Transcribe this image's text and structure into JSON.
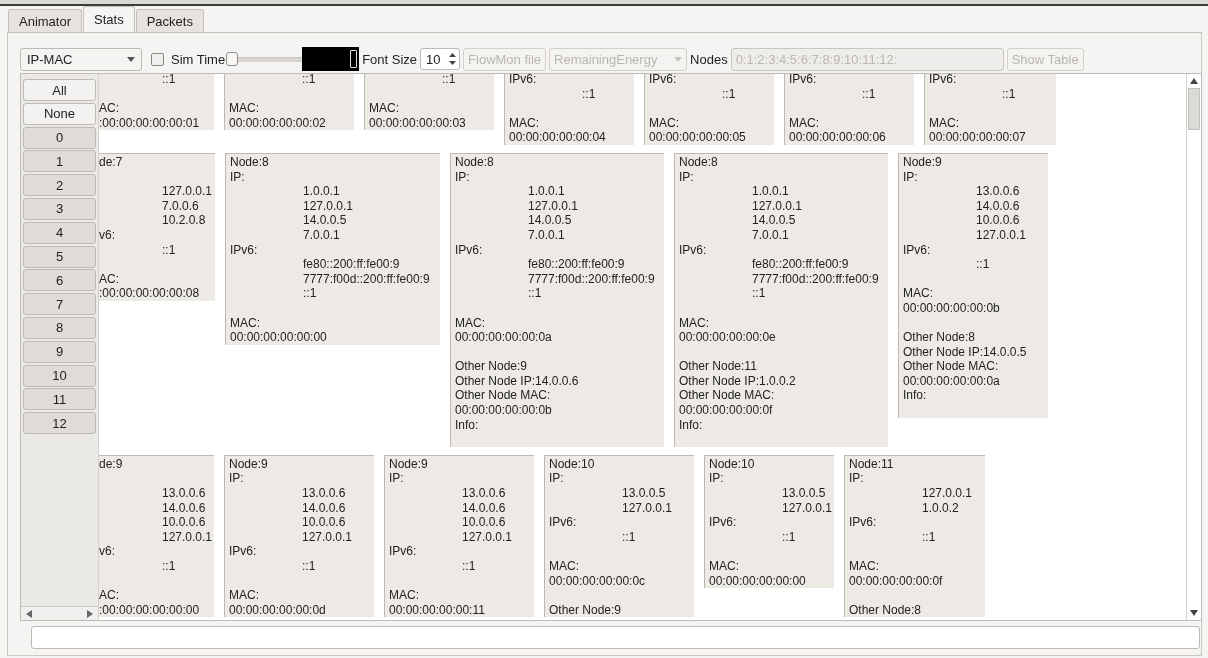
{
  "tabs": [
    {
      "label": "Animator",
      "selected": false
    },
    {
      "label": "Stats",
      "selected": true
    },
    {
      "label": "Packets",
      "selected": false
    }
  ],
  "toolbar": {
    "mode": "IP-MAC",
    "sim_time": {
      "label": "Sim Time",
      "checked": false,
      "level": 0
    },
    "font_size": {
      "label": "Font Size",
      "value": "10"
    },
    "flowmon_button": {
      "label": "FlowMon file",
      "disabled": true
    },
    "metric": {
      "value": "RemainingEnergy",
      "disabled": true
    },
    "nodes": {
      "label": "Nodes",
      "value": "0:1:2:3:4:5:6:7:8:9:10:11:12:",
      "disabled": true
    },
    "show_table": {
      "label": "Show Table",
      "disabled": true
    }
  },
  "node_filter": {
    "actions": [
      "All",
      "None"
    ],
    "nodes": [
      {
        "label": "0",
        "selected": true
      },
      {
        "label": "1",
        "selected": true
      },
      {
        "label": "2",
        "selected": true
      },
      {
        "label": "3",
        "selected": true
      },
      {
        "label": "4",
        "selected": true
      },
      {
        "label": "5",
        "selected": true
      },
      {
        "label": "6",
        "selected": true
      },
      {
        "label": "7",
        "selected": true
      },
      {
        "label": "8",
        "selected": true
      },
      {
        "label": "9",
        "selected": true
      },
      {
        "label": "10",
        "selected": true
      },
      {
        "label": "11",
        "selected": true
      },
      {
        "label": "12",
        "selected": true
      }
    ]
  },
  "card_rows": [
    [
      {
        "lines": [
          {
            "kind": "value",
            "text": "::1"
          },
          {
            "kind": "blank"
          },
          {
            "kind": "label",
            "text": "AC:"
          },
          {
            "kind": "label",
            "text": ":00:00:00:00:00:01"
          }
        ]
      },
      {
        "lines": [
          {
            "kind": "value",
            "text": "::1"
          },
          {
            "kind": "blank"
          },
          {
            "kind": "label",
            "text": "MAC:"
          },
          {
            "kind": "label",
            "text": "00:00:00:00:00:02"
          }
        ]
      },
      {
        "lines": [
          {
            "kind": "value",
            "text": "::1"
          },
          {
            "kind": "blank"
          },
          {
            "kind": "label",
            "text": "MAC:"
          },
          {
            "kind": "label",
            "text": "00:00:00:00:00:03"
          }
        ]
      },
      {
        "lines": [
          {
            "kind": "label",
            "text": "IPv6:"
          },
          {
            "kind": "value",
            "text": "::1"
          },
          {
            "kind": "blank"
          },
          {
            "kind": "label",
            "text": "MAC:"
          },
          {
            "kind": "label",
            "text": "00:00:00:00:00:04"
          }
        ]
      },
      {
        "lines": [
          {
            "kind": "label",
            "text": "IPv6:"
          },
          {
            "kind": "value",
            "text": "::1"
          },
          {
            "kind": "blank"
          },
          {
            "kind": "label",
            "text": "MAC:"
          },
          {
            "kind": "label",
            "text": "00:00:00:00:00:05"
          }
        ]
      },
      {
        "lines": [
          {
            "kind": "label",
            "text": "IPv6:"
          },
          {
            "kind": "value",
            "text": "::1"
          },
          {
            "kind": "blank"
          },
          {
            "kind": "label",
            "text": "MAC:"
          },
          {
            "kind": "label",
            "text": "00:00:00:00:00:06"
          }
        ]
      },
      {
        "lines": [
          {
            "kind": "label",
            "text": "IPv6:"
          },
          {
            "kind": "value",
            "text": "::1"
          },
          {
            "kind": "blank"
          },
          {
            "kind": "label",
            "text": "MAC:"
          },
          {
            "kind": "label",
            "text": "00:00:00:00:00:07"
          }
        ]
      }
    ],
    [
      {
        "lines": [
          {
            "kind": "label",
            "text": "de:7"
          },
          {
            "kind": "blank"
          },
          {
            "kind": "value",
            "text": "127.0.0.1"
          },
          {
            "kind": "value",
            "text": "7.0.0.6"
          },
          {
            "kind": "value",
            "text": "10.2.0.8"
          },
          {
            "kind": "label",
            "text": "v6:"
          },
          {
            "kind": "value",
            "text": "::1"
          },
          {
            "kind": "blank"
          },
          {
            "kind": "label",
            "text": "AC:"
          },
          {
            "kind": "label",
            "text": ":00:00:00:00:00:08"
          }
        ]
      },
      {
        "lines": [
          {
            "kind": "label",
            "text": "Node:8"
          },
          {
            "kind": "label",
            "text": "IP:"
          },
          {
            "kind": "value",
            "text": "1.0.0.1"
          },
          {
            "kind": "value",
            "text": "127.0.0.1"
          },
          {
            "kind": "value",
            "text": "14.0.0.5"
          },
          {
            "kind": "value",
            "text": "7.0.0.1"
          },
          {
            "kind": "label",
            "text": "IPv6:"
          },
          {
            "kind": "value",
            "text": "fe80::200:ff:fe00:9"
          },
          {
            "kind": "value",
            "text": "7777:f00d::200:ff:fe00:9"
          },
          {
            "kind": "value",
            "text": "::1"
          },
          {
            "kind": "blank"
          },
          {
            "kind": "label",
            "text": "MAC:"
          },
          {
            "kind": "label",
            "text": "00:00:00:00:00:00"
          }
        ]
      },
      {
        "lines": [
          {
            "kind": "label",
            "text": "Node:8"
          },
          {
            "kind": "label",
            "text": "IP:"
          },
          {
            "kind": "value",
            "text": "1.0.0.1"
          },
          {
            "kind": "value",
            "text": "127.0.0.1"
          },
          {
            "kind": "value",
            "text": "14.0.0.5"
          },
          {
            "kind": "value",
            "text": "7.0.0.1"
          },
          {
            "kind": "label",
            "text": "IPv6:"
          },
          {
            "kind": "value",
            "text": "fe80::200:ff:fe00:9"
          },
          {
            "kind": "value",
            "text": "7777:f00d::200:ff:fe00:9"
          },
          {
            "kind": "value",
            "text": "::1"
          },
          {
            "kind": "blank"
          },
          {
            "kind": "label",
            "text": "MAC:"
          },
          {
            "kind": "label",
            "text": "00:00:00:00:00:0a"
          },
          {
            "kind": "blank"
          },
          {
            "kind": "label",
            "text": "Other Node:9"
          },
          {
            "kind": "label",
            "text": "Other Node IP:14.0.0.6"
          },
          {
            "kind": "label",
            "text": "Other Node MAC:"
          },
          {
            "kind": "label",
            "text": "00:00:00:00:00:0b"
          },
          {
            "kind": "label",
            "text": "Info:"
          },
          {
            "kind": "blank"
          }
        ]
      },
      {
        "lines": [
          {
            "kind": "label",
            "text": "Node:8"
          },
          {
            "kind": "label",
            "text": "IP:"
          },
          {
            "kind": "value",
            "text": "1.0.0.1"
          },
          {
            "kind": "value",
            "text": "127.0.0.1"
          },
          {
            "kind": "value",
            "text": "14.0.0.5"
          },
          {
            "kind": "value",
            "text": "7.0.0.1"
          },
          {
            "kind": "label",
            "text": "IPv6:"
          },
          {
            "kind": "value",
            "text": "fe80::200:ff:fe00:9"
          },
          {
            "kind": "value",
            "text": "7777:f00d::200:ff:fe00:9"
          },
          {
            "kind": "value",
            "text": "::1"
          },
          {
            "kind": "blank"
          },
          {
            "kind": "label",
            "text": "MAC:"
          },
          {
            "kind": "label",
            "text": "00:00:00:00:00:0e"
          },
          {
            "kind": "blank"
          },
          {
            "kind": "label",
            "text": "Other Node:11"
          },
          {
            "kind": "label",
            "text": "Other Node IP:1.0.0.2"
          },
          {
            "kind": "label",
            "text": "Other Node MAC:"
          },
          {
            "kind": "label",
            "text": "00:00:00:00:00:0f"
          },
          {
            "kind": "label",
            "text": "Info:"
          },
          {
            "kind": "blank"
          }
        ]
      },
      {
        "lines": [
          {
            "kind": "label",
            "text": "Node:9"
          },
          {
            "kind": "label",
            "text": "IP:"
          },
          {
            "kind": "value",
            "text": "13.0.0.6"
          },
          {
            "kind": "value",
            "text": "14.0.0.6"
          },
          {
            "kind": "value",
            "text": "10.0.0.6"
          },
          {
            "kind": "value",
            "text": "127.0.0.1"
          },
          {
            "kind": "label",
            "text": "IPv6:"
          },
          {
            "kind": "value",
            "text": "::1"
          },
          {
            "kind": "blank"
          },
          {
            "kind": "label",
            "text": "MAC:"
          },
          {
            "kind": "label",
            "text": "00:00:00:00:00:0b"
          },
          {
            "kind": "blank"
          },
          {
            "kind": "label",
            "text": "Other Node:8"
          },
          {
            "kind": "label",
            "text": "Other Node IP:14.0.0.5"
          },
          {
            "kind": "label",
            "text": "Other Node MAC:"
          },
          {
            "kind": "label",
            "text": "00:00:00:00:00:0a"
          },
          {
            "kind": "label",
            "text": "Info:"
          },
          {
            "kind": "blank"
          }
        ]
      }
    ],
    [
      {
        "lines": [
          {
            "kind": "label",
            "text": "de:9"
          },
          {
            "kind": "blank"
          },
          {
            "kind": "value",
            "text": "13.0.0.6"
          },
          {
            "kind": "value",
            "text": "14.0.0.6"
          },
          {
            "kind": "value",
            "text": "10.0.0.6"
          },
          {
            "kind": "value",
            "text": "127.0.0.1"
          },
          {
            "kind": "label",
            "text": "v6:"
          },
          {
            "kind": "value",
            "text": "::1"
          },
          {
            "kind": "blank"
          },
          {
            "kind": "label",
            "text": "AC:"
          },
          {
            "kind": "label",
            "text": ":00:00:00:00:00:00"
          }
        ]
      },
      {
        "lines": [
          {
            "kind": "label",
            "text": "Node:9"
          },
          {
            "kind": "label",
            "text": "IP:"
          },
          {
            "kind": "value",
            "text": "13.0.0.6"
          },
          {
            "kind": "value",
            "text": "14.0.0.6"
          },
          {
            "kind": "value",
            "text": "10.0.0.6"
          },
          {
            "kind": "value",
            "text": "127.0.0.1"
          },
          {
            "kind": "label",
            "text": "IPv6:"
          },
          {
            "kind": "value",
            "text": "::1"
          },
          {
            "kind": "blank"
          },
          {
            "kind": "label",
            "text": "MAC:"
          },
          {
            "kind": "label",
            "text": "00:00:00:00:00:0d"
          }
        ]
      },
      {
        "lines": [
          {
            "kind": "label",
            "text": "Node:9"
          },
          {
            "kind": "label",
            "text": "IP:"
          },
          {
            "kind": "value",
            "text": "13.0.0.6"
          },
          {
            "kind": "value",
            "text": "14.0.0.6"
          },
          {
            "kind": "value",
            "text": "10.0.0.6"
          },
          {
            "kind": "value",
            "text": "127.0.0.1"
          },
          {
            "kind": "label",
            "text": "IPv6:"
          },
          {
            "kind": "value",
            "text": "::1"
          },
          {
            "kind": "blank"
          },
          {
            "kind": "label",
            "text": "MAC:"
          },
          {
            "kind": "label",
            "text": "00:00:00:00:00:11"
          }
        ]
      },
      {
        "lines": [
          {
            "kind": "label",
            "text": "Node:10"
          },
          {
            "kind": "label",
            "text": "IP:"
          },
          {
            "kind": "value",
            "text": "13.0.0.5"
          },
          {
            "kind": "value",
            "text": "127.0.0.1"
          },
          {
            "kind": "label",
            "text": "IPv6:"
          },
          {
            "kind": "value",
            "text": "::1"
          },
          {
            "kind": "blank"
          },
          {
            "kind": "label",
            "text": "MAC:"
          },
          {
            "kind": "label",
            "text": "00:00:00:00:00:0c"
          },
          {
            "kind": "blank"
          },
          {
            "kind": "label",
            "text": "Other Node:9"
          }
        ]
      },
      {
        "lines": [
          {
            "kind": "label",
            "text": "Node:10"
          },
          {
            "kind": "label",
            "text": "IP:"
          },
          {
            "kind": "value",
            "text": "13.0.0.5"
          },
          {
            "kind": "value",
            "text": "127.0.0.1"
          },
          {
            "kind": "label",
            "text": "IPv6:"
          },
          {
            "kind": "value",
            "text": "::1"
          },
          {
            "kind": "blank"
          },
          {
            "kind": "label",
            "text": "MAC:"
          },
          {
            "kind": "label",
            "text": "00:00:00:00:00:00"
          }
        ]
      },
      {
        "lines": [
          {
            "kind": "label",
            "text": "Node:11"
          },
          {
            "kind": "label",
            "text": "IP:"
          },
          {
            "kind": "value",
            "text": "127.0.0.1"
          },
          {
            "kind": "value",
            "text": "1.0.0.2"
          },
          {
            "kind": "label",
            "text": "IPv6:"
          },
          {
            "kind": "value",
            "text": "::1"
          },
          {
            "kind": "blank"
          },
          {
            "kind": "label",
            "text": "MAC:"
          },
          {
            "kind": "label",
            "text": "00:00:00:00:00:0f"
          },
          {
            "kind": "blank"
          },
          {
            "kind": "label",
            "text": "Other Node:8"
          }
        ]
      }
    ]
  ]
}
